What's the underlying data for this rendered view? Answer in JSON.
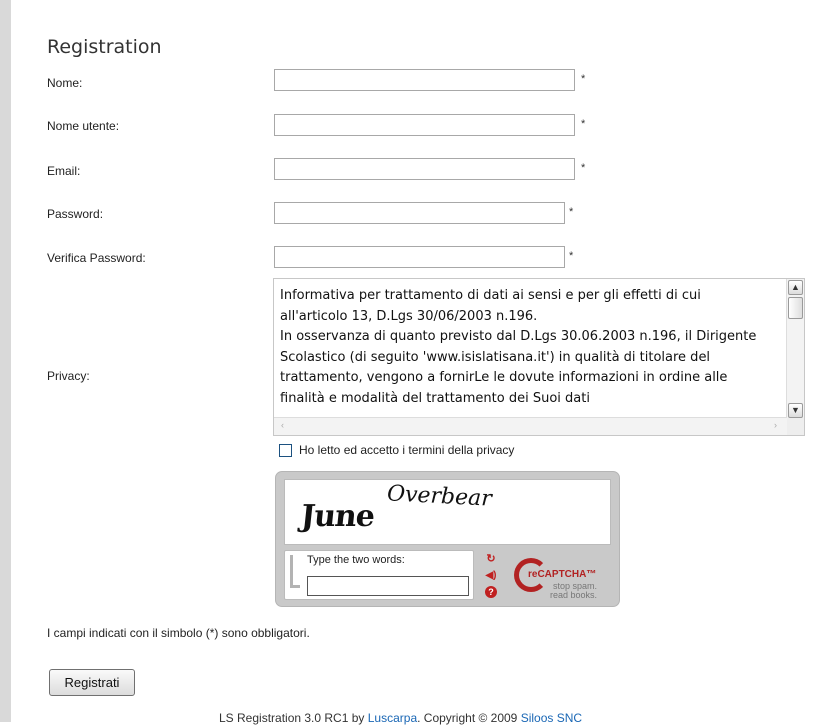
{
  "form": {
    "title": "Registration",
    "fields": [
      {
        "label": "Nome:",
        "value": "",
        "required_mark": "*"
      },
      {
        "label": "Nome utente:",
        "value": "",
        "required_mark": "*"
      },
      {
        "label": "Email:",
        "value": "",
        "required_mark": "*"
      },
      {
        "label": "Password:",
        "value": "",
        "required_mark": "*"
      },
      {
        "label": "Verifica Password:",
        "value": "",
        "required_mark": "*"
      }
    ],
    "privacy_label": "Privacy:",
    "privacy_text": "Informativa per trattamento di dati ai sensi e per gli effetti di cui all'articolo 13, D.Lgs 30/06/2003 n.196.\nIn osservanza di quanto previsto dal D.Lgs 30.06.2003 n.196, il Dirigente Scolastico (di seguito 'www.isislatisana.it') in qualità di titolare del trattamento, vengono a fornirLe le dovute informazioni in ordine alle finalità e modalità del trattamento dei Suoi dati",
    "privacy_checkbox_label": "Ho letto ed accetto i termini della privacy",
    "privacy_checked": false,
    "required_note": "I campi indicati con il simbolo (*) sono obbligatori.",
    "submit_label": "Registrati"
  },
  "captcha": {
    "word1": "June",
    "word2": "Overbear",
    "prompt": "Type the two words:",
    "logo_text": "reCAPTCHA™",
    "tagline_1": "stop spam.",
    "tagline_2": "read books.",
    "icons": [
      "refresh-icon",
      "audio-icon",
      "help-icon"
    ],
    "brand_color": "#b22222"
  },
  "footer": {
    "product": "LS Registration 3.0 RC1 by",
    "author_link": "Luscarpa",
    "copyright": ". Copyright © 2009",
    "company_link": "Siloos SNC"
  }
}
